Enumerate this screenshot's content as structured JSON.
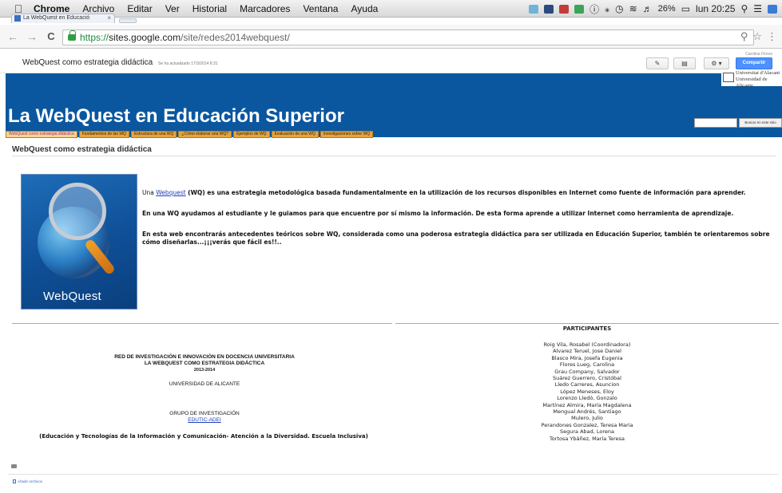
{
  "menubar": {
    "app_name": "Chrome",
    "items": [
      "Archivo",
      "Editar",
      "Ver",
      "Historial",
      "Marcadores",
      "Ventana",
      "Ayuda"
    ],
    "battery": "26%",
    "clock": "lun 20:25"
  },
  "browser": {
    "tab_title": "La WebQuest en Educació",
    "url_scheme": "https://",
    "url_host": "sites.google.com",
    "url_path": "/site/redes2014webquest/"
  },
  "sites_header": {
    "site_name": "WebQuest como estrategia didáctica",
    "updated": "Se ha actualizado 17/3/2014 8:31",
    "user": "Carolina Flores",
    "share_label": "Compartir"
  },
  "banner": {
    "title": "La WebQuest en Educación Superior",
    "university_line1": "Universitat d'Alacant",
    "university_line2": "Universidad de Alicante",
    "search_button": "Buscar en este sitio"
  },
  "nav": [
    {
      "label": "WebQuest como estrategia didáctica",
      "active": true
    },
    {
      "label": "Fundamentos de las WQ",
      "active": false
    },
    {
      "label": "Estructura de una WQ",
      "active": false
    },
    {
      "label": "¿Cómo elaborar una WQ?",
      "active": false
    },
    {
      "label": "Ejemplos de WQ",
      "active": false
    },
    {
      "label": "Evaluación de una WQ",
      "active": false
    },
    {
      "label": "Investigaciones sobre WQ",
      "active": false
    }
  ],
  "content": {
    "page_title": "WebQuest como estrategia didáctica",
    "image_label": "WebQuest",
    "p1_pre": "Una ",
    "p1_link": "Webquest",
    "p1_post": " (WQ) es una estrategia metodológica  basada fundamentalmente  en  la utilización de los recursos disponibles en Internet como fuente de información para aprender.",
    "p2": "En una  WQ ayudamos al estudiante y le guiamos para que encuentre por sí mismo la información. De esta forma aprende a utilizar Internet como herramienta de aprendizaje.",
    "p3_line1": "En esta web encontrarás  antecedentes  teóricos sobre WQ, considerada como una poderosa estrategia didáctica para  ser utilizada en Educación Superior, también te orientaremos sobre",
    "p3_line2": "cómo  diseñarlas...¡¡¡verás que fácil es!!.."
  },
  "footer": {
    "red_line1": "RED DE INVESTIGACIÓN E INNOVACIÓN EN DOCENCIA UNIVERSITARIA",
    "red_line2": "LA WEBQUEST COMO ESTRATEGIA DIDÁCTICA",
    "years": "2013-2014",
    "university": "UNIVERSIDAD DE ALICANTE",
    "grupo": "GRUPO DE INVESTIGACIÓN",
    "grupo_link": "EDUTIC-ADEI",
    "education": "(Educación y Tecnologías de la Información y Comunicación- Atención a la Diversidad. Escuela Inclusiva)",
    "participants_title": "PARTICIPANTES",
    "participants": [
      "Roig Vila, Rosabel (Coordinadora)",
      "Alvarez Teruel, Jose Daniel",
      "Blasco Mira, Josefa Eugenia",
      "Flores Lueg, Carolina",
      "Grau Company, Salvador",
      "Suárez Guerrero, Cristóbal",
      "Lledo Carreres, Asuncion",
      "López Meneses, Eloy",
      "Lorenzo Lledó, Gonzalo",
      "Martínez Almira, María Magdalena",
      "Mengual Andrés, Santiago",
      "Mulero, Julio",
      "Perandones Gonzalez, Teresa Maria",
      "Segura Abad, Lorena",
      "Tortosa Ybáñez, María Teresa"
    ],
    "attach_label": "Añadir archivos"
  }
}
